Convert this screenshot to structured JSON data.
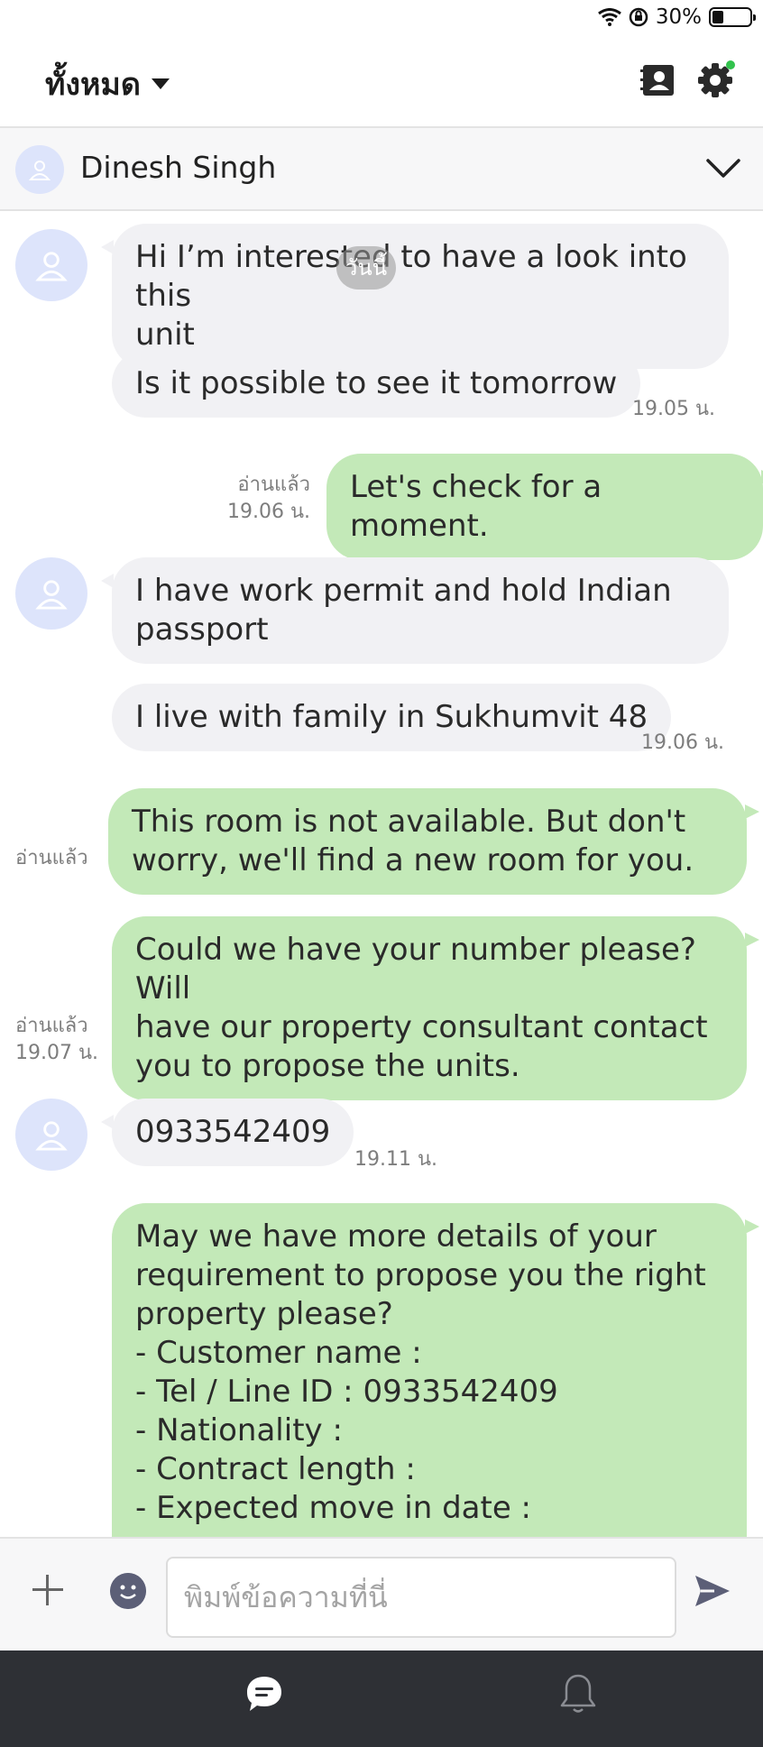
{
  "status_bar": {
    "battery_text": "30%",
    "battery_level": 0.3
  },
  "header": {
    "filter_label": "ทั้งหมด",
    "icons": [
      "dropdown-caret-icon",
      "contacts-icon",
      "settings-icon"
    ],
    "settings_notification_color": "#32c24d"
  },
  "chat_partner": {
    "name": "Dinesh Singh",
    "icons": [
      "user-avatar-icon",
      "chevron-down-icon"
    ]
  },
  "date_chip": "วันนี้",
  "messages": [
    {
      "direction": "in",
      "text": "Hi I’m interested to have a look into this\nunit"
    },
    {
      "direction": "in",
      "text": "Is it possible to see it tomorrow",
      "time": "19.05 น."
    },
    {
      "direction": "out",
      "text": "Let's check for a moment.",
      "read": "อ่านแล้ว",
      "time": "19.06 น."
    },
    {
      "direction": "in",
      "text": "I have work permit and hold Indian\npassport"
    },
    {
      "direction": "in",
      "text": "I live with family in Sukhumvit 48",
      "time": "19.06 น."
    },
    {
      "direction": "out",
      "text": "This room is not available.  But don't\nworry, we'll find a new room for you.",
      "read": "อ่านแล้ว"
    },
    {
      "direction": "out",
      "text": "Could we have your number please? Will\nhave our property consultant contact\nyou to propose the units.",
      "read": "อ่านแล้ว",
      "time": "19.07 น."
    },
    {
      "direction": "in",
      "text": "0933542409",
      "time": "19.11 น."
    },
    {
      "direction": "out",
      "text": "May we have more details of your\nrequirement to propose you the right\nproperty please?\n- Customer name :\n- Tel / Line ID : 0933542409\n- Nationality :\n- Contract length :\n- Expected move in date :"
    }
  ],
  "composer": {
    "placeholder": "พิมพ์ข้อความที่นี่",
    "value": "",
    "icons": [
      "plus-icon",
      "emoji-icon",
      "send-icon"
    ]
  },
  "bottom_nav": {
    "items": [
      "chat-icon",
      "bell-icon"
    ]
  },
  "colors": {
    "incoming_bubble": "#f1f1f4",
    "outgoing_bubble": "#c3e9b8",
    "avatar_bg": "#dde4fb",
    "bottom_nav_bg": "#2e3035",
    "send_icon": "#5c5f77"
  }
}
